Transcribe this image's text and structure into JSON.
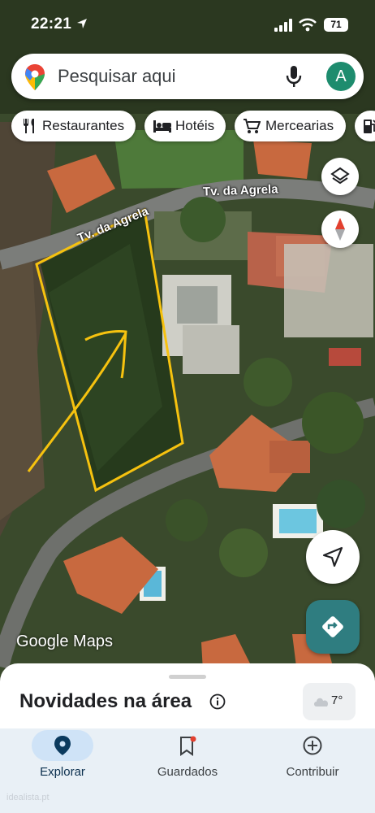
{
  "status_bar": {
    "time": "22:21",
    "battery": "71",
    "icons": [
      "location-arrow-icon",
      "signal-icon",
      "wifi-icon",
      "battery-icon"
    ]
  },
  "search": {
    "placeholder": "Pesquisar aqui",
    "avatar_letter": "A",
    "icons": [
      "google-maps-pin-icon",
      "microphone-icon"
    ]
  },
  "chips": [
    {
      "label": "Restaurantes",
      "icon": "fork-knife-icon"
    },
    {
      "label": "Hotéis",
      "icon": "bed-icon"
    },
    {
      "label": "Mercearias",
      "icon": "cart-icon"
    },
    {
      "label": "",
      "icon": "gas-station-icon"
    }
  ],
  "map": {
    "road_labels": [
      "Tv. da Agrela",
      "Tv. da Agrela"
    ],
    "attribution": "Google Maps",
    "buttons": [
      "layers-icon",
      "compass-icon",
      "my-location-icon",
      "directions-icon"
    ],
    "annotation_color": "#f6c20f"
  },
  "sheet": {
    "title": "Novidades na área",
    "weather_temp": "7°",
    "icons": [
      "info-icon",
      "cloud-icon"
    ]
  },
  "nav": {
    "items": [
      {
        "label": "Explorar",
        "icon": "explore-pin-icon",
        "active": true
      },
      {
        "label": "Guardados",
        "icon": "bookmark-icon",
        "active": false
      },
      {
        "label": "Contribuir",
        "icon": "add-circle-icon",
        "active": false
      }
    ]
  },
  "watermark": "idealista.pt",
  "colors": {
    "accent_green": "#1e8c6e",
    "directions_teal": "#2f7d80",
    "nav_active_pill": "#cfe3f7"
  }
}
